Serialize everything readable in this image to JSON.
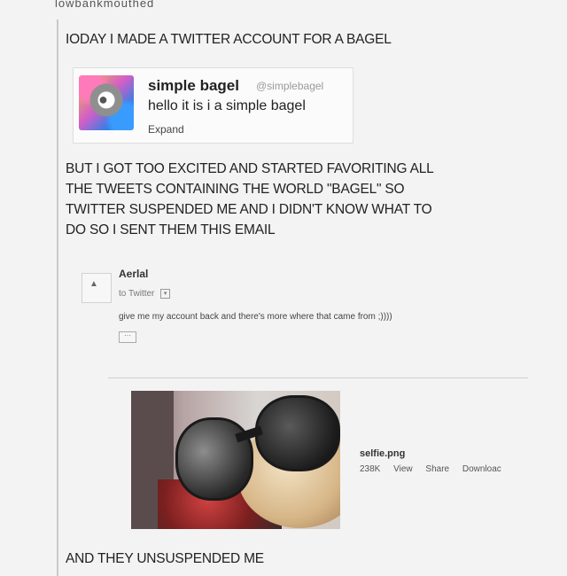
{
  "header_fragment": "lowbankmouthed",
  "post": {
    "intro": "IODAY I MADE A TWITTER ACCOUNT FOR A BAGEL",
    "middle_lines": [
      "BUT I GOT TOO EXCITED AND STARTED FAVORITING ALL",
      "THE TWEETS CONTAINING THE WORLD \"BAGEL\" SO",
      "TWITTER SUSPENDED ME AND I DIDN'T KNOW WHAT TO",
      "DO SO I SENT THEM THIS EMAIL"
    ],
    "ending": "AND THEY UNSUSPENDED ME"
  },
  "tweet": {
    "name": "simple bagel",
    "handle": "@simplebagel",
    "text": "hello it is i a simple bagel",
    "expand": "Expand"
  },
  "email": {
    "sender": "Aerlal",
    "to": "to Twitter",
    "body": "give me my account back and there's more where that came from ;))))",
    "ellipsis": "···"
  },
  "attachment": {
    "name": "selfie.png",
    "size": "238K",
    "view": "View",
    "share": "Share",
    "download": "Downloac"
  }
}
